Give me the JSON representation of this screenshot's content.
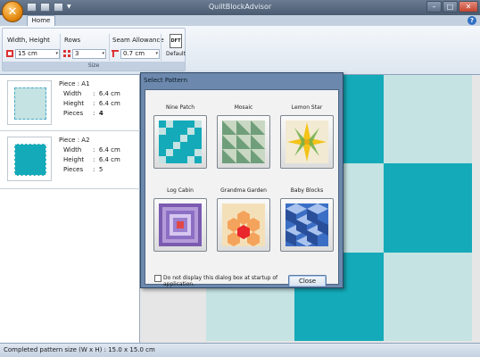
{
  "app": {
    "title": "QuiltBlockAdvisor",
    "orb_glyph": "✕",
    "help_label": "?"
  },
  "window_controls": {
    "minimize": "–",
    "maximize": "□",
    "close": "✕"
  },
  "ribbon": {
    "tabs": [
      {
        "label": "Home",
        "active": true
      }
    ],
    "group_size": {
      "label": "Size",
      "width_height": {
        "label": "Width, Height",
        "value": "15  cm"
      },
      "rows": {
        "label": "Rows",
        "value": "3"
      },
      "seam_allowance": {
        "label": "Seam Allowance",
        "value": "0.7  cm"
      },
      "default_button": {
        "icon_text": "DFT",
        "label": "Default"
      }
    }
  },
  "pieces": [
    {
      "title": "Piece :  A1",
      "width_label": "Width",
      "width": "6.4 cm",
      "height_label": "Hieght",
      "height": "6.4 cm",
      "pieces_label": "Pieces",
      "pieces": "4",
      "color": "#c4e3e2"
    },
    {
      "title": "Piece :  A2",
      "width_label": "Width",
      "width": "6.4 cm",
      "height_label": "Height",
      "height": "6.4 cm",
      "pieces_label": "Pieces",
      "pieces": "5",
      "color": "#14aab9"
    }
  ],
  "quilt": {
    "light_color": "#c4e3e2",
    "dark_color": "#14aab9",
    "grid": [
      [
        "L",
        "D",
        "L"
      ],
      [
        "D",
        "L",
        "D"
      ],
      [
        "L",
        "D",
        "L"
      ]
    ]
  },
  "dialog": {
    "title": "Select Pattern",
    "patterns": [
      {
        "name": "Nine Patch"
      },
      {
        "name": "Mosaic"
      },
      {
        "name": "Lemon Star"
      },
      {
        "name": "Log Cabin"
      },
      {
        "name": "Grandma Garden"
      },
      {
        "name": "Baby Blocks"
      }
    ],
    "checkbox_label": "Do not display this dialog box at startup of application.",
    "close_label": "Close"
  },
  "status": {
    "text": "Completed pattern size (W x H) : 15.0 x 15.0 cm"
  },
  "colors": {
    "accent": "#14aab9",
    "light": "#c4e3e2"
  }
}
